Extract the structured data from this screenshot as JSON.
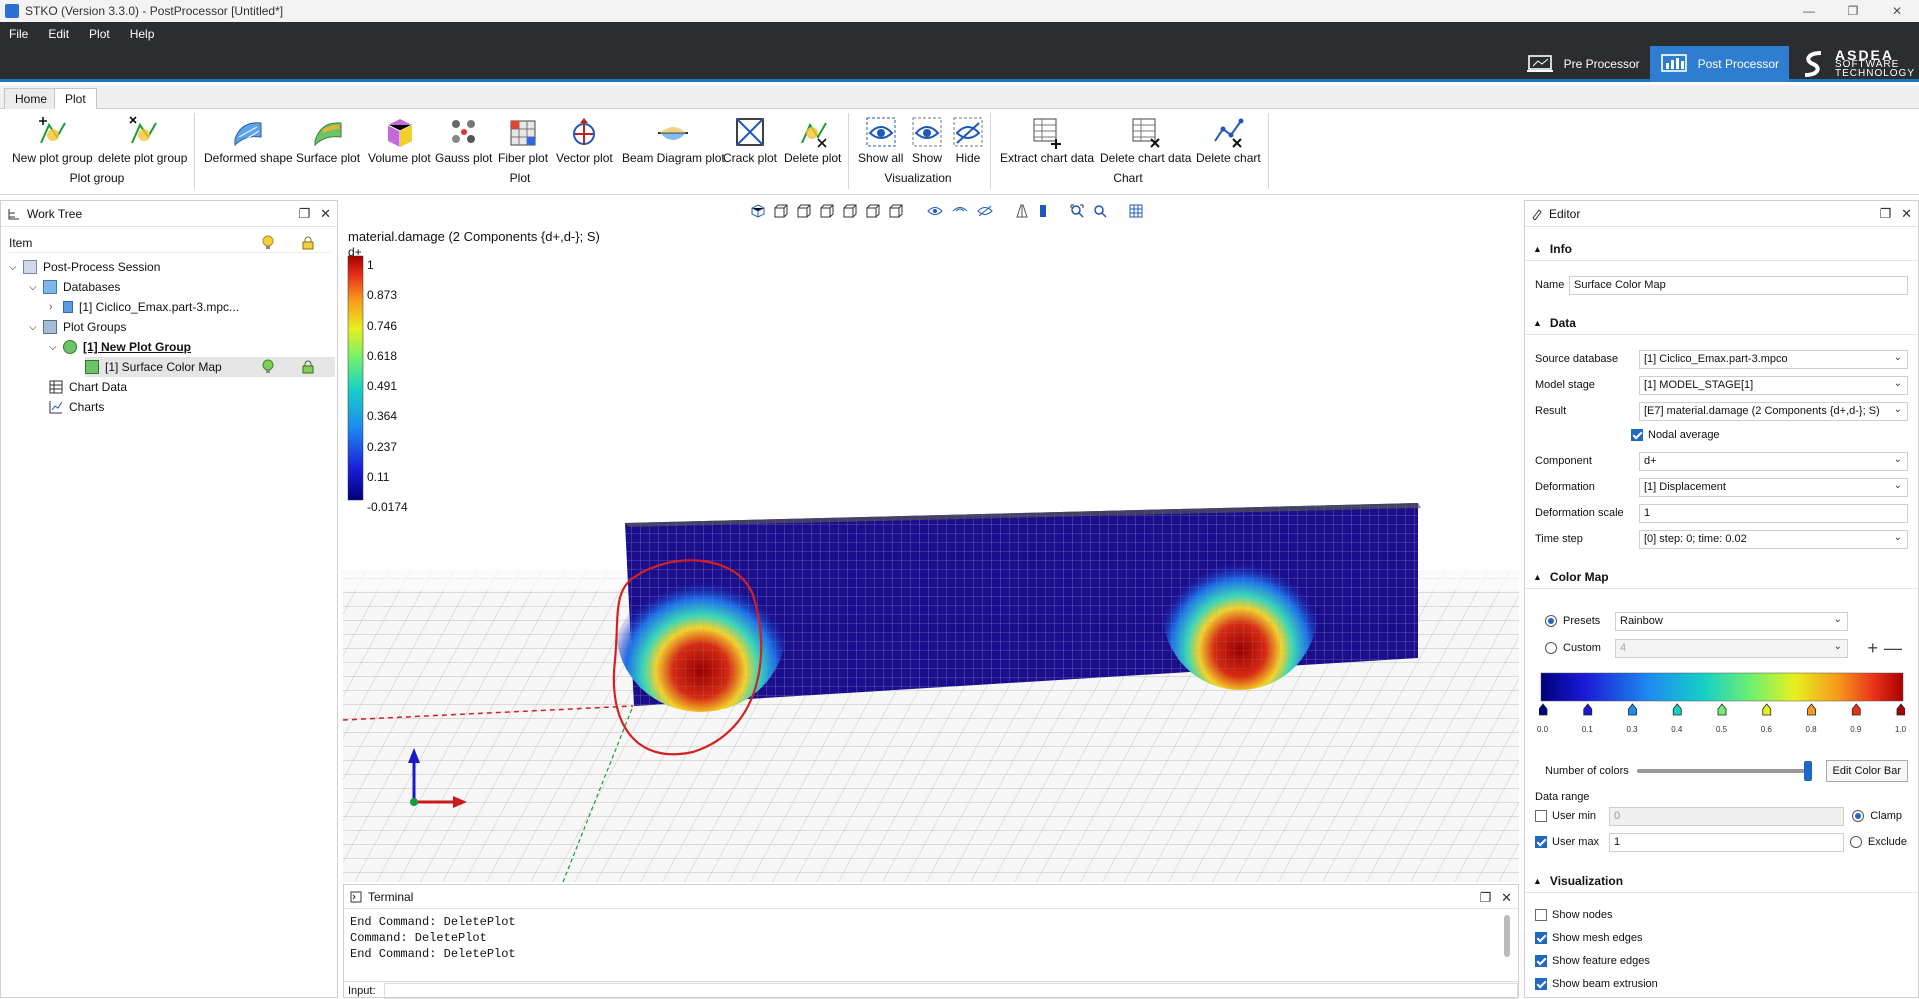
{
  "window": {
    "title": "STKO (Version 3.3.0) - PostProcessor [Untitled*]"
  },
  "menu": [
    "File",
    "Edit",
    "Plot",
    "Help"
  ],
  "mode_switch": {
    "pre": "Pre Processor",
    "post": "Post Processor",
    "logo_main": "ASDEA",
    "logo_sub1": "SOFTWARE",
    "logo_sub2": "TECHNOLOGY"
  },
  "tabs": [
    "Home",
    "Plot"
  ],
  "ribbon": {
    "buttons": {
      "new_plot_group": "New plot group",
      "delete_plot_group": "delete plot group",
      "deformed_shape": "Deformed shape",
      "surface_plot": "Surface plot",
      "volume_plot": "Volume plot",
      "gauss_plot": "Gauss plot",
      "fiber_plot": "Fiber plot",
      "vector_plot": "Vector plot",
      "beam_diagram_plot": "Beam Diagram plot",
      "crack_plot": "Crack plot",
      "delete_plot": "Delete plot",
      "show_all": "Show all",
      "show": "Show",
      "hide": "Hide",
      "extract_chart_data": "Extract chart data",
      "delete_chart_data": "Delete chart data",
      "delete_chart": "Delete chart"
    },
    "groups": {
      "plot_group": "Plot group",
      "plot": "Plot",
      "visualization": "Visualization",
      "chart": "Chart"
    }
  },
  "worktree": {
    "title": "Work Tree",
    "header": "Item",
    "session": "Post-Process Session",
    "databases": "Databases",
    "database_item": "[1] Ciclico_Emax.part-3.mpc...",
    "plot_groups": "Plot Groups",
    "plot_group_item": "[1] New Plot Group",
    "plot_item": "[1] Surface Color Map",
    "chart_data": "Chart Data",
    "charts": "Charts"
  },
  "viewport": {
    "result_title": "material.damage (2 Components {d+,d-}; S)",
    "component": "d+",
    "legend_values": [
      "1",
      "0.873",
      "0.746",
      "0.618",
      "0.491",
      "0.364",
      "0.237",
      "0.11",
      "-0.0174"
    ]
  },
  "terminal": {
    "title": "Terminal",
    "lines": [
      "End Command: DeletePlot",
      "Command: DeletePlot",
      "End Command: DeletePlot"
    ],
    "input_label": "Input:"
  },
  "editor": {
    "title": "Editor",
    "info": {
      "section": "Info",
      "name_label": "Name",
      "name_value": "Surface Color Map"
    },
    "data": {
      "section": "Data",
      "source_label": "Source database",
      "source_value": "[1] Ciclico_Emax.part-3.mpco",
      "stage_label": "Model stage",
      "stage_value": "[1] MODEL_STAGE[1]",
      "result_label": "Result",
      "result_value": "[E7] material.damage (2 Components {d+,d-}; S)",
      "nodal_avg": "Nodal average",
      "component_label": "Component",
      "component_value": "d+",
      "deformation_label": "Deformation",
      "deformation_value": "[1] Displacement",
      "scale_label": "Deformation scale",
      "scale_value": "1",
      "time_label": "Time step",
      "time_value": "[0] step: 0; time: 0.02"
    },
    "colormap": {
      "section": "Color Map",
      "presets_label": "Presets",
      "presets_value": "Rainbow",
      "custom_label": "Custom",
      "custom_value": "4",
      "stops": [
        "0.0",
        "0.1",
        "0.3",
        "0.4",
        "0.5",
        "0.6",
        "0.8",
        "0.9",
        "1.0"
      ],
      "stop_colors": [
        "#00007a",
        "#1a1ad6",
        "#1e8cf0",
        "#16d0c6",
        "#6ef070",
        "#e6f020",
        "#f79a1c",
        "#e8311a",
        "#a80000"
      ],
      "num_colors_label": "Number of colors",
      "edit_btn": "Edit Color Bar",
      "num_colors_level": 1.0,
      "range_label": "Data range",
      "user_min_label": "User min",
      "user_min_value": "0",
      "user_max_label": "User max",
      "user_max_value": "1",
      "clamp": "Clamp",
      "exclude": "Exclude"
    },
    "visualization": {
      "section": "Visualization",
      "show_nodes": "Show nodes",
      "show_mesh_edges": "Show mesh edges",
      "show_feature_edges": "Show feature edges",
      "show_beam_extrusion": "Show beam extrusion"
    }
  },
  "colors": {
    "accent": "#2f7dd1",
    "menubar": "#2b2d31",
    "annotation": "#d62020"
  }
}
